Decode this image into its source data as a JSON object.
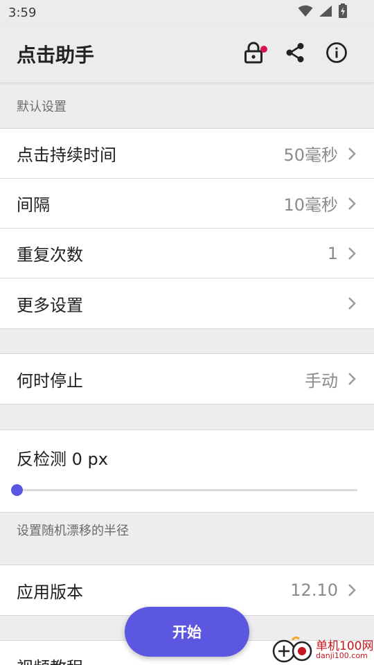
{
  "status_bar": {
    "time": "3:59",
    "icons": [
      "wifi-icon",
      "signal-icon",
      "battery-charging-icon"
    ]
  },
  "app_bar": {
    "title": "点击助手",
    "actions": [
      "lock-icon",
      "share-icon",
      "info-icon"
    ],
    "notification_dot_color": "#d6164e"
  },
  "section_default": {
    "header": "默认设置",
    "rows": [
      {
        "label": "点击持续时间",
        "value": "50毫秒"
      },
      {
        "label": "间隔",
        "value": "10毫秒"
      },
      {
        "label": "重复次数",
        "value": "1"
      },
      {
        "label": "更多设置",
        "value": ""
      }
    ]
  },
  "section_stop": {
    "rows": [
      {
        "label": "何时停止",
        "value": "手动"
      }
    ]
  },
  "anti_detect": {
    "label": "反检测 0 px",
    "slider_value": 0,
    "caption": "设置随机漂移的半径"
  },
  "section_version": {
    "rows": [
      {
        "label": "应用版本",
        "value": "12.10"
      }
    ]
  },
  "section_video": {
    "rows": [
      {
        "label": "视频教程",
        "value": ""
      }
    ]
  },
  "fab": {
    "label": "开始"
  },
  "watermark": {
    "line1": "单机100网",
    "line2": "danji100.com"
  },
  "colors": {
    "accent": "#5b57e0",
    "background": "#ededf0",
    "card": "#ffffff",
    "secondary_text": "#8a8a8a"
  }
}
